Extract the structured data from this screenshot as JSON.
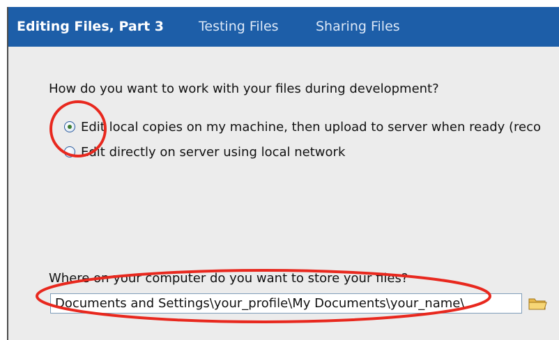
{
  "tabs": [
    {
      "label": "Editing Files, Part 3",
      "active": true
    },
    {
      "label": "Testing Files",
      "active": false
    },
    {
      "label": "Sharing Files",
      "active": false
    }
  ],
  "question1": "How do you want to work with your files during development?",
  "options": [
    {
      "label": "Edit local copies on my machine, then upload to server when ready (reco",
      "selected": true
    },
    {
      "label": "Edit directly on server using local network",
      "selected": false
    }
  ],
  "question2": "Where on your computer do you want to store your files?",
  "path_field": {
    "value": "Documents and Settings\\your_profile\\My Documents\\your_name\\"
  },
  "icons": {
    "browse": "folder-icon"
  },
  "colors": {
    "tab_bar": "#1d5ea8",
    "annotation": "#e8281e",
    "background": "#ececec"
  }
}
